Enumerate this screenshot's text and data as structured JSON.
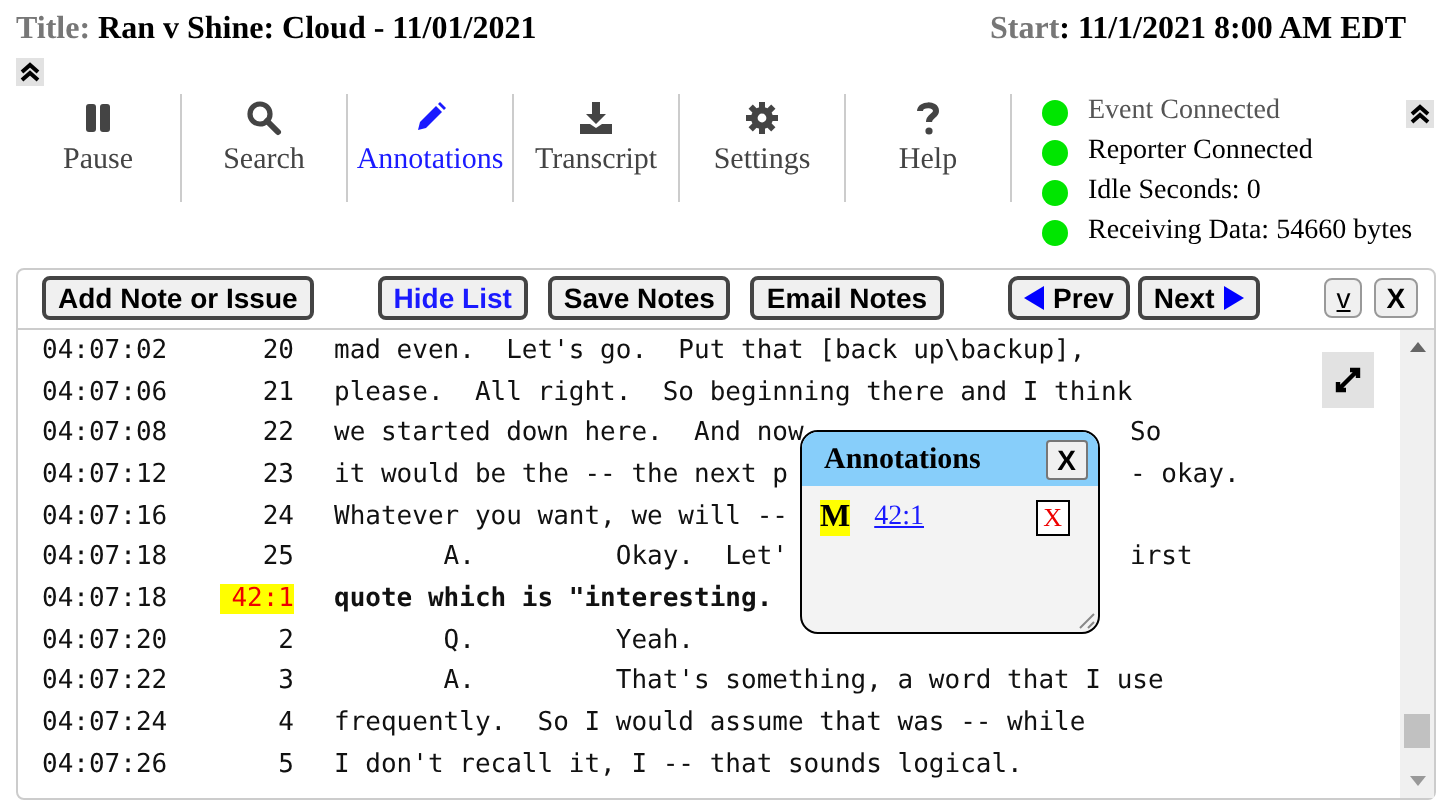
{
  "header": {
    "title_label": "Title:",
    "title": "Ran v Shine: Cloud - 11/01/2021",
    "start_label": "Start",
    "start_value": ": 11/1/2021 8:00 AM EDT"
  },
  "toolbar": [
    {
      "label": "Pause",
      "selected": false
    },
    {
      "label": "Search",
      "selected": false
    },
    {
      "label": "Annotations",
      "selected": true
    },
    {
      "label": "Transcript",
      "selected": false
    },
    {
      "label": "Settings",
      "selected": false
    },
    {
      "label": "Help",
      "selected": false
    }
  ],
  "status": [
    {
      "label": "Event Connected",
      "color": "#00e600"
    },
    {
      "label": "Reporter Connected",
      "color": "#00e600"
    },
    {
      "label": "Idle Seconds: 0",
      "color": "#00e600"
    },
    {
      "label": "Receiving Data: 54660 bytes",
      "color": "#00e600"
    }
  ],
  "buttons": [
    {
      "label": "Add Note or Issue",
      "kind": "plain",
      "highlighted": false
    },
    {
      "label": "Hide List",
      "kind": "plain",
      "highlighted": true
    },
    {
      "label": "Save Notes",
      "kind": "plain",
      "highlighted": false
    },
    {
      "label": "Email Notes",
      "kind": "plain",
      "highlighted": false
    },
    {
      "label": "Prev",
      "kind": "prev",
      "highlighted": false
    },
    {
      "label": "Next",
      "kind": "next",
      "highlighted": false
    },
    {
      "label": "v",
      "kind": "small",
      "highlighted": false
    },
    {
      "label": "X",
      "kind": "small",
      "highlighted": false
    }
  ],
  "transcript": [
    {
      "time": "04:07:02",
      "line": "20",
      "text": "mad even.  Let's go.  Put that [back up\\backup],",
      "bold": false,
      "highlighted": false
    },
    {
      "time": "04:07:06",
      "line": "21",
      "text": "please.  All right.  So beginning there and I think",
      "bold": false,
      "highlighted": false
    },
    {
      "time": "04:07:08",
      "line": "22",
      "text": "we started down here.  And now",
      "tail": "So",
      "bold": false,
      "highlighted": false
    },
    {
      "time": "04:07:12",
      "line": "23",
      "text": "it would be the -- the next p",
      "tail": "- okay.",
      "bold": false,
      "highlighted": false
    },
    {
      "time": "04:07:16",
      "line": "24",
      "text": "Whatever you want, we will --",
      "bold": false,
      "highlighted": false
    },
    {
      "time": "04:07:18",
      "line": "25",
      "text": "       A.         Okay.  Let'",
      "tail": "irst",
      "bold": false,
      "highlighted": false
    },
    {
      "time": "04:07:18",
      "line": "42:1",
      "text": "quote which is \"interesting.",
      "bold": true,
      "highlighted": true
    },
    {
      "time": "04:07:20",
      "line": "2",
      "text": "       Q.         Yeah.",
      "bold": false,
      "highlighted": false
    },
    {
      "time": "04:07:22",
      "line": "3",
      "text": "       A.         That's something, a word that I use",
      "bold": false,
      "highlighted": false
    },
    {
      "time": "04:07:24",
      "line": "4",
      "text": "frequently.  So I would assume that was -- while",
      "bold": false,
      "highlighted": false
    },
    {
      "time": "04:07:26",
      "line": "5",
      "text": "I don't recall it, I -- that sounds logical.",
      "bold": false,
      "highlighted": false
    }
  ],
  "annotations_popup": {
    "title": "Annotations",
    "close": "X",
    "items": [
      {
        "mark": "M",
        "link": "42:1",
        "delete": "X"
      }
    ]
  }
}
